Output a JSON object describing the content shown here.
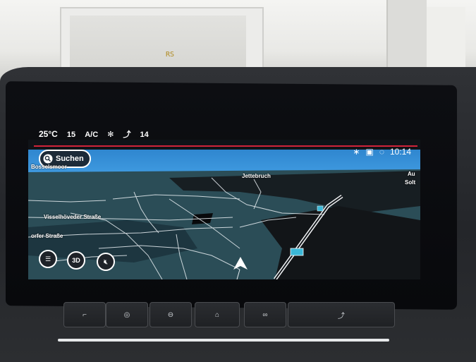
{
  "status_bar": {
    "temperature": "25°C",
    "fan_level": "15",
    "ac_label": "A/C",
    "seat_heat_level": "14",
    "time": "10:14"
  },
  "search": {
    "label": "Suchen"
  },
  "map_buttons": {
    "view_mode": "3D"
  },
  "map_labels": {
    "village_left": "Bosselsmoor",
    "village_top": "Jettebruch",
    "street_1": "Visselhöveder Straße",
    "street_2": "orfer Straße",
    "edge_right_1": "Au",
    "edge_right_2": "Solt"
  },
  "wall_sign": "RS",
  "icons": [
    "fan-icon",
    "seat-heating-icon",
    "bluetooth-icon",
    "car-icon",
    "signal-icon",
    "search-icon",
    "menu-icon",
    "mute-icon",
    "position-arrow-icon",
    "seat-icon",
    "steering-heat-icon",
    "car-settings-icon",
    "home-icon",
    "app-grid-icon",
    "seat-ventilation-icon"
  ],
  "colors": {
    "map_land": "#2b4d57",
    "map_sky": "#2f86cf",
    "map_forest": "#15191d",
    "roads": "#e8eef2",
    "accent_red": "#d0233a",
    "highway_sign": "#3bb8d8"
  }
}
